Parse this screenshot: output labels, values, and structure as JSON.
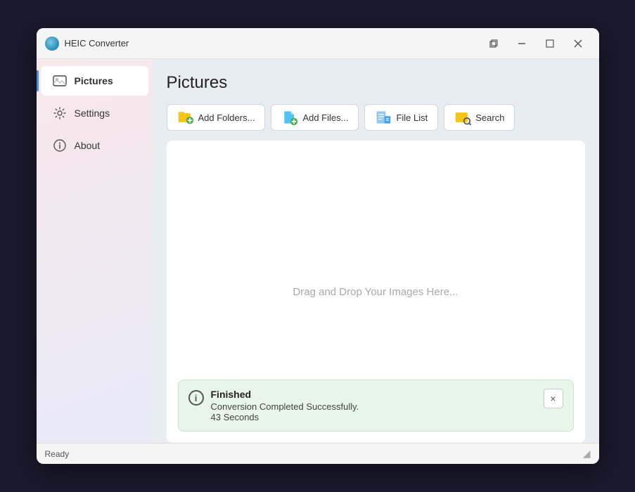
{
  "window": {
    "title": "HEIC Converter",
    "min_label": "–",
    "max_label": "□",
    "close_label": "✕",
    "restore_label": "❐"
  },
  "sidebar": {
    "items": [
      {
        "id": "pictures",
        "label": "Pictures",
        "icon": "🖼",
        "active": true
      },
      {
        "id": "settings",
        "label": "Settings",
        "icon": "⚙"
      },
      {
        "id": "about",
        "label": "About",
        "icon": "ℹ"
      }
    ]
  },
  "main": {
    "title": "Pictures",
    "toolbar": [
      {
        "id": "add-folders",
        "label": "Add Folders...",
        "icon": "📁"
      },
      {
        "id": "add-files",
        "label": "Add Files...",
        "icon": "📂"
      },
      {
        "id": "file-list",
        "label": "File List",
        "icon": "☰"
      },
      {
        "id": "search",
        "label": "Search",
        "icon": "🔍"
      }
    ],
    "drop_zone_text": "Drag and Drop  Your Images Here..."
  },
  "notification": {
    "title": "Finished",
    "message": "Conversion Completed Successfully.",
    "time": "43 Seconds",
    "close_label": "×"
  },
  "status_bar": {
    "text": "Ready"
  }
}
